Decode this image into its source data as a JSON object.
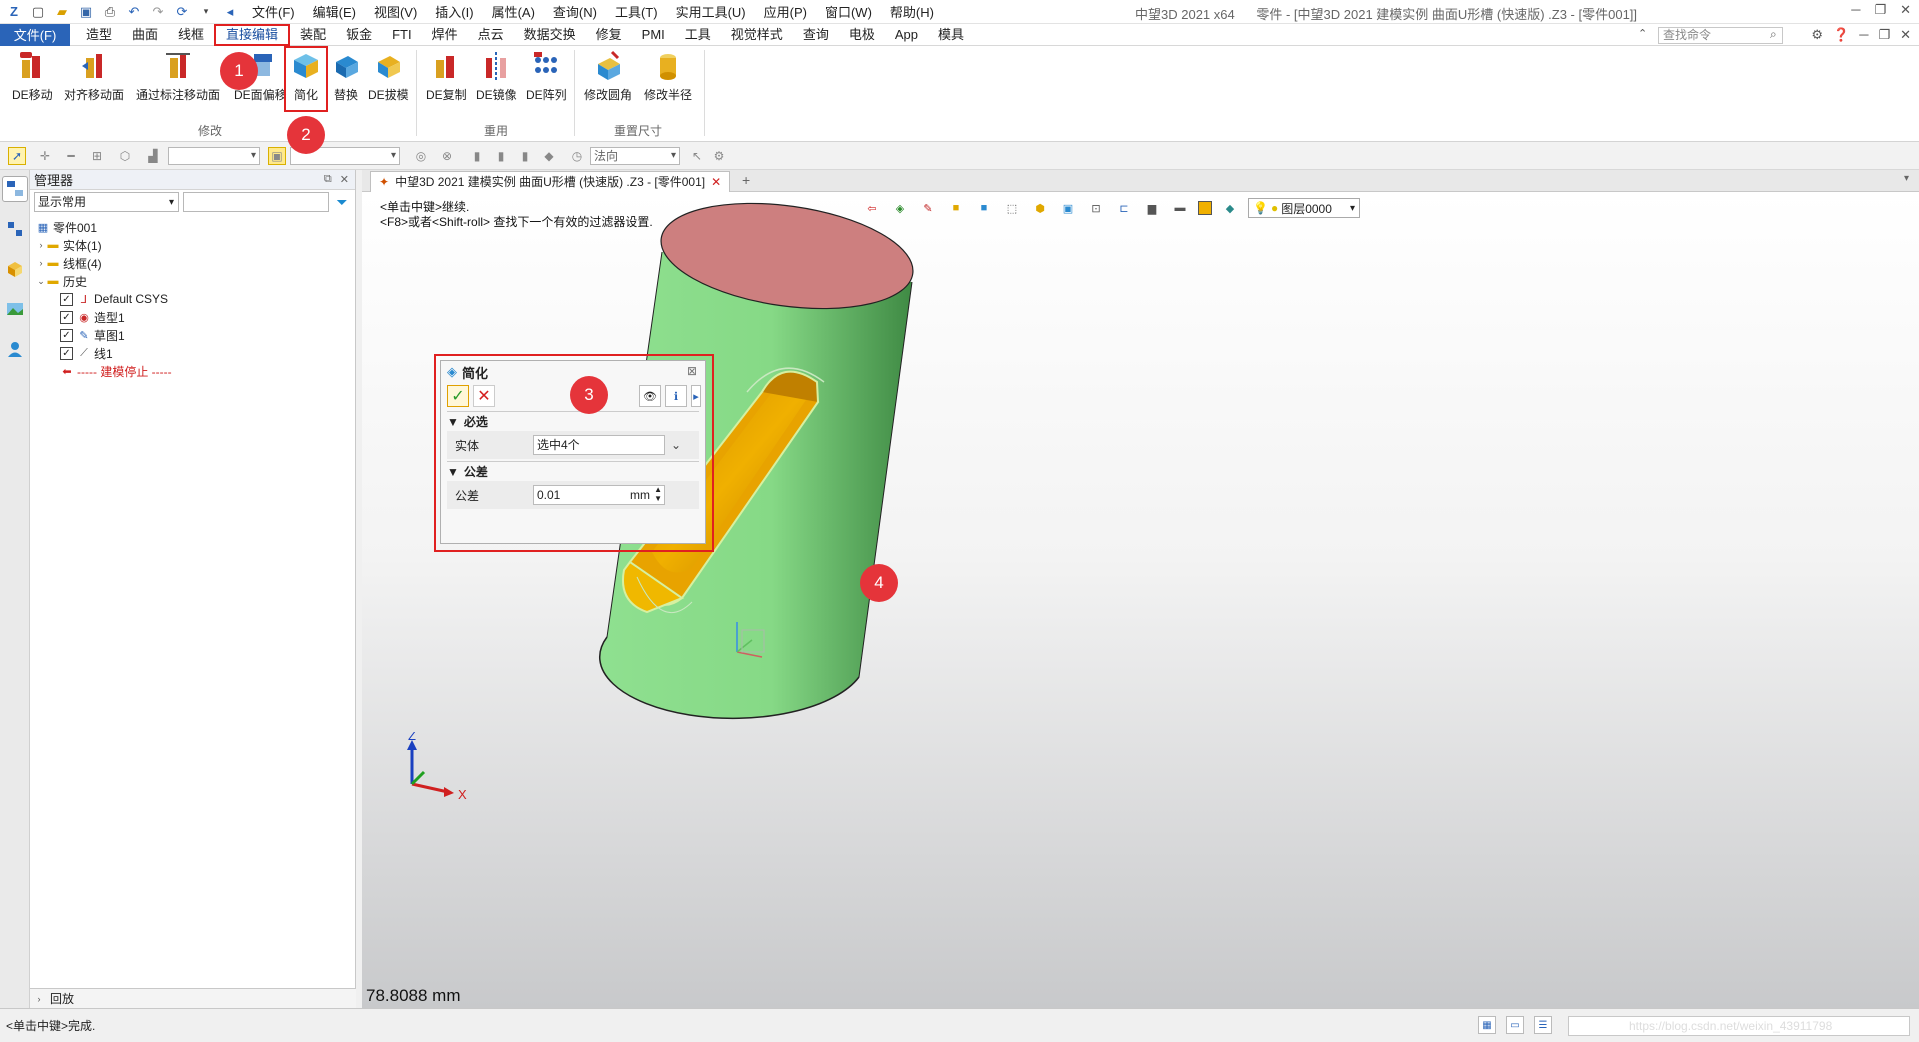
{
  "menubar": {
    "items": [
      "文件(F)",
      "编辑(E)",
      "视图(V)",
      "插入(I)",
      "属性(A)",
      "查询(N)",
      "工具(T)",
      "实用工具(U)",
      "应用(P)",
      "窗口(W)",
      "帮助(H)"
    ],
    "app_version": "中望3D 2021 x64",
    "window_title": "零件 - [中望3D 2021 建模实例 曲面U形槽 (快速版) .Z3 - [零件001]]"
  },
  "ribbon_tabs": {
    "file_tab": "文件(F)",
    "tabs": [
      "造型",
      "曲面",
      "线框",
      "直接编辑",
      "装配",
      "钣金",
      "FTI",
      "焊件",
      "点云",
      "数据交换",
      "修复",
      "PMI",
      "工具",
      "视觉样式",
      "查询",
      "电极",
      "App",
      "模具"
    ],
    "active_tab": "直接编辑",
    "search_placeholder": "查找命令"
  },
  "ribbon": {
    "buttons": [
      "DE移动",
      "对齐移动面",
      "通过标注移动面",
      "DE面偏移",
      "简化",
      "替换",
      "DE拔模",
      "DE复制",
      "DE镜像",
      "DE阵列",
      "修改圆角",
      "修改半径"
    ],
    "groups": [
      "修改",
      "重用",
      "重置尺寸"
    ]
  },
  "toolbar2": {
    "direction_combo": "法向"
  },
  "manager": {
    "title": "管理器",
    "filter_select": "显示常用",
    "tree": {
      "root": "零件001",
      "solid": "实体(1)",
      "wireframe": "线框(4)",
      "history": "历史",
      "history_items": [
        "Default CSYS",
        "造型1",
        "草图1",
        "线1"
      ],
      "stop_marker": "----- 建模停止 -----"
    },
    "bottom": "回放"
  },
  "document": {
    "tab_title": "中望3D 2021 建模实例 曲面U形槽 (快速版) .Z3 - [零件001]",
    "hint_line1": "<单击中键>继续.",
    "hint_line2": "<F8>或者<Shift-roll> 查找下一个有效的过滤器设置.",
    "layer_combo": "图层0000",
    "measure": "78.8088 mm",
    "axis_z": "Z",
    "axis_x": "X"
  },
  "dialog": {
    "title": "简化",
    "section_required": "必选",
    "field_solid_label": "实体",
    "field_solid_value": "选中4个",
    "section_tolerance": "公差",
    "field_tolerance_label": "公差",
    "field_tolerance_value": "0.01",
    "field_tolerance_unit": "mm"
  },
  "annotations": [
    "1",
    "2",
    "3",
    "4"
  ],
  "statusbar": {
    "text": "<单击中键>完成.",
    "watermark": "https://blog.csdn.net/weixin_43911798"
  },
  "colors": {
    "accent": "#2a64b8",
    "annotation_red": "#e5343a",
    "cylinder_green": "#8bd888",
    "cylinder_top": "#cd7f7f",
    "slot_orange": "#e8a300"
  }
}
